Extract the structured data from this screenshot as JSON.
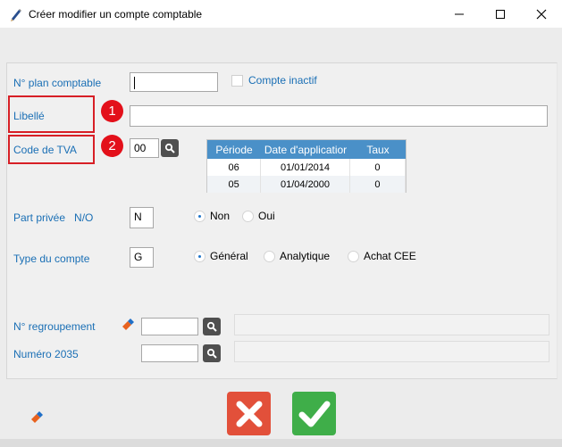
{
  "window": {
    "title": "Créer modifier un compte comptable",
    "controls": [
      "minimize-icon",
      "maximize-icon",
      "close-icon"
    ]
  },
  "form": {
    "plan_label": "N° plan comptable",
    "plan_value": "",
    "inactive_label": "Compte inactif",
    "inactive_checked": false,
    "libelle_label": "Libellé",
    "libelle_value": "",
    "tva_label": "Code de TVA",
    "tva_value": "00",
    "badges": [
      "1",
      "2"
    ],
    "vat_table": {
      "columns": [
        "Période",
        "Date d'applicatior",
        "Taux"
      ],
      "rows": [
        [
          "06",
          "01/01/2014",
          "0"
        ],
        [
          "05",
          "01/04/2000",
          "0"
        ]
      ]
    },
    "part_privee_label": "Part privée   N/O",
    "part_privee_value": "N",
    "part_privee_options": [
      "Non",
      "Oui"
    ],
    "part_privee_selected": "Non",
    "type_label": "Type du compte",
    "type_value": "G",
    "type_options": [
      "Général",
      "Analytique",
      "Achat CEE"
    ],
    "type_selected": "Général",
    "regroupement_label": "N° regroupement",
    "regroupement_value": "",
    "numero2035_label": "Numéro 2035",
    "numero2035_value": ""
  },
  "colors": {
    "accent_blue": "#1a6fb5",
    "cancel_red": "#e2503a",
    "ok_green": "#3fae49",
    "badge_red": "#e3101a"
  }
}
